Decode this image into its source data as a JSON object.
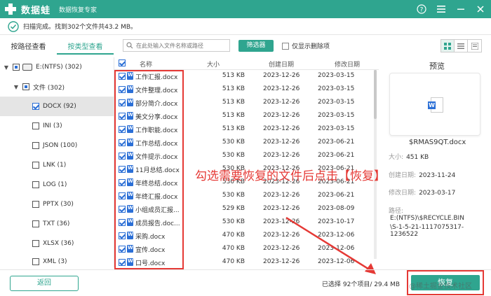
{
  "app": {
    "name": "数据蛙",
    "subtitle": "数据恢复专家"
  },
  "status": {
    "text": "扫描完成。找到302个文件共43.2 MB。"
  },
  "left_tabs": [
    {
      "label": "按路径查看",
      "active": false
    },
    {
      "label": "按类型查看",
      "active": true
    }
  ],
  "tree": [
    {
      "label": "E:(NTFS) (302)",
      "level": 0,
      "expanded": true,
      "check": "partial"
    },
    {
      "label": "文件 (302)",
      "level": 1,
      "expanded": true,
      "check": "partial"
    },
    {
      "label": "DOCX (92)",
      "level": 2,
      "check": "checked",
      "selected": true
    },
    {
      "label": "INI (3)",
      "level": 2,
      "check": "none"
    },
    {
      "label": "JSON (100)",
      "level": 2,
      "check": "none"
    },
    {
      "label": "LNK (1)",
      "level": 2,
      "check": "none"
    },
    {
      "label": "LOG (1)",
      "level": 2,
      "check": "none"
    },
    {
      "label": "PPTX (30)",
      "level": 2,
      "check": "none"
    },
    {
      "label": "TXT (36)",
      "level": 2,
      "check": "none"
    },
    {
      "label": "XLSX (36)",
      "level": 2,
      "check": "none"
    },
    {
      "label": "XML (3)",
      "level": 2,
      "check": "none"
    }
  ],
  "search": {
    "placeholder": "在此处输入文件名称或路径"
  },
  "filter_button": "筛选器",
  "deleted_only": "仅显示删除项",
  "table": {
    "headers": {
      "name": "名称",
      "size": "大小",
      "created": "创建日期",
      "modified": "修改日期"
    },
    "rows": [
      {
        "name": "工作汇报.docx",
        "size": "513 KB",
        "created": "2023-12-26",
        "modified": "2023-03-15"
      },
      {
        "name": "文件整理.docx",
        "size": "513 KB",
        "created": "2023-12-26",
        "modified": "2023-03-15"
      },
      {
        "name": "部分简介.docx",
        "size": "513 KB",
        "created": "2023-12-26",
        "modified": "2023-03-15"
      },
      {
        "name": "美文分享.docx",
        "size": "513 KB",
        "created": "2023-12-26",
        "modified": "2023-03-15"
      },
      {
        "name": "工作职能.docx",
        "size": "513 KB",
        "created": "2023-12-26",
        "modified": "2023-03-15"
      },
      {
        "name": "工作总结.docx",
        "size": "530 KB",
        "created": "2023-12-26",
        "modified": "2023-06-21"
      },
      {
        "name": "文件提示.docx",
        "size": "530 KB",
        "created": "2023-12-26",
        "modified": "2023-06-21"
      },
      {
        "name": "11月总结.docx",
        "size": "530 KB",
        "created": "2023-12-26",
        "modified": "2023-06-21"
      },
      {
        "name": "年终总结.docx",
        "size": "530 KB",
        "created": "2023-12-26",
        "modified": "2023-06-21"
      },
      {
        "name": "年终汇报.docx",
        "size": "530 KB",
        "created": "2023-12-26",
        "modified": "2023-06-21"
      },
      {
        "name": "小组成员汇报...",
        "size": "529 KB",
        "created": "2023-12-26",
        "modified": "2023-08-09"
      },
      {
        "name": "成员报告.doc...",
        "size": "530 KB",
        "created": "2023-12-26",
        "modified": "2023-10-17"
      },
      {
        "name": "采购.docx",
        "size": "470 KB",
        "created": "2023-12-26",
        "modified": "2023-12-06"
      },
      {
        "name": "宣传.docx",
        "size": "470 KB",
        "created": "2023-12-26",
        "modified": "2023-12-06"
      },
      {
        "name": "口号.docx",
        "size": "470 KB",
        "created": "2023-12-26",
        "modified": "2023-12-06"
      }
    ]
  },
  "preview": {
    "title": "预览",
    "filename": "$RMAS9QT.docx",
    "size_label": "大小",
    "size_value": "451 KB",
    "created_label": "创建日期",
    "created_value": "2023-11-24",
    "modified_label": "修改日期",
    "modified_value": "2023-03-17",
    "path_label": "路径",
    "path_line1": "E:(NTFS)\\$RECYCLE.BIN",
    "path_line2": "\\S-1-5-21-1117075317-1236522"
  },
  "annotation": "勾选需要恢复的文件后点击【恢复】",
  "footer": {
    "back": "返回",
    "selected_info": "已选择 92个项目/ 29.4 MB",
    "recover": "恢复",
    "watermark": "@稀土掘金技术社区"
  },
  "colors": {
    "brand": "#2fa58f",
    "highlight": "#e53935",
    "checkbox": "#2b6fd6"
  }
}
